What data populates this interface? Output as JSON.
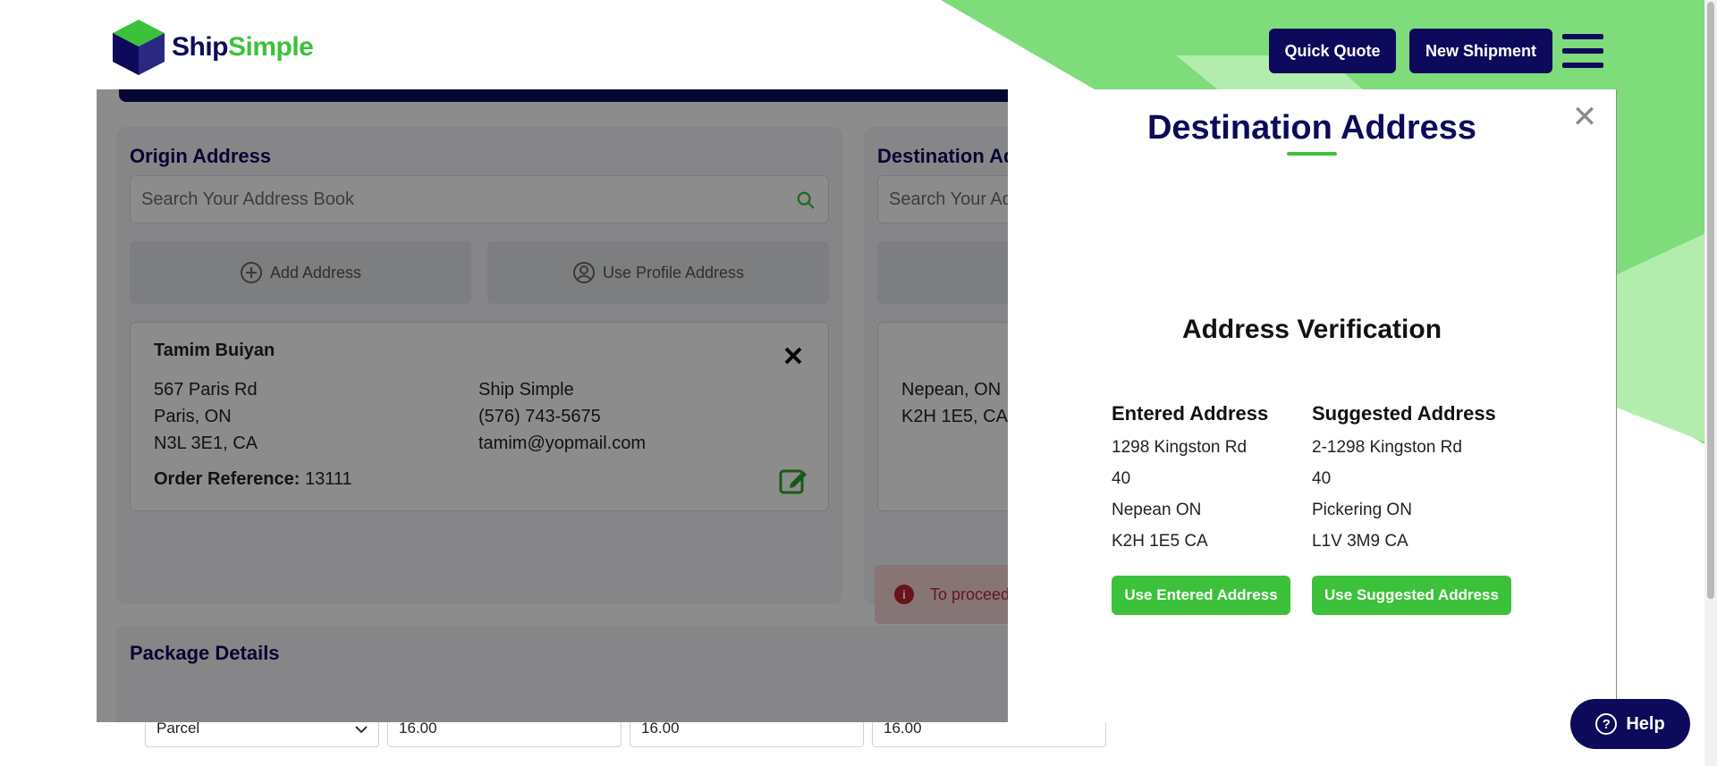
{
  "brand": {
    "name_part1": "Ship",
    "name_part2": "Simple",
    "color_primary": "#0d0a5c",
    "color_accent": "#3cc13b"
  },
  "header": {
    "quick_quote": "Quick Quote",
    "new_shipment": "New Shipment",
    "menu_icon": "hamburger-icon"
  },
  "origin": {
    "title": "Origin Address",
    "search_placeholder": "Search Your Address Book",
    "add_address": "Add Address",
    "use_profile": "Use Profile Address",
    "card": {
      "name": "Tamim Buiyan",
      "line1": "567 Paris Rd",
      "line2": "Paris, ON",
      "line3": "N3L 3E1, CA",
      "company": "Ship Simple",
      "phone": "(576) 743-5675",
      "email": "tamim@yopmail.com",
      "order_ref_label": "Order Reference:",
      "order_ref_value": "13111"
    }
  },
  "destination": {
    "title": "Destination Ad",
    "search_placeholder": "Search Your Ad",
    "card": {
      "line1": "Nepean, ON",
      "line2": "K2H 1E5, CA"
    },
    "alert": "To proceed"
  },
  "package": {
    "title": "Package Details",
    "type_value": "Parcel",
    "dim1": "16.00",
    "dim2": "16.00",
    "dim3": "16.00"
  },
  "modal": {
    "title": "Destination Address",
    "close_icon": "close-icon",
    "verification_title": "Address Verification",
    "entered": {
      "heading": "Entered Address",
      "lines": [
        "1298 Kingston Rd",
        "40",
        "Nepean ON",
        "K2H 1E5 CA"
      ],
      "button": "Use Entered Address"
    },
    "suggested": {
      "heading": "Suggested Address",
      "lines": [
        "2-1298 Kingston Rd",
        "40",
        "Pickering ON",
        "L1V 3M9 CA"
      ],
      "button": "Use Suggested Address"
    }
  },
  "help": {
    "label": "Help"
  }
}
